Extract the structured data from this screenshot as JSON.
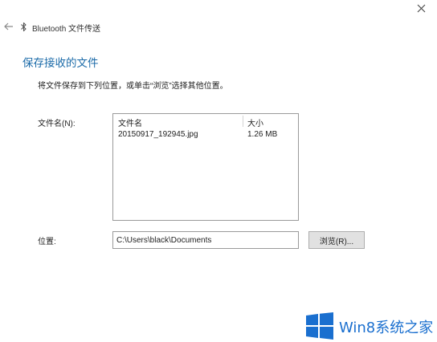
{
  "window": {
    "title": "Bluetooth 文件传送"
  },
  "page": {
    "title": "保存接收的文件",
    "instruction": "将文件保存到下列位置，或单击“浏览”选择其他位置。"
  },
  "files": {
    "label": "文件名(N):",
    "columns": {
      "name": "文件名",
      "size": "大小"
    },
    "rows": [
      {
        "name": "20150917_192945.jpg",
        "size": "1.26 MB"
      }
    ]
  },
  "location": {
    "label": "位置:",
    "value": "C:\\Users\\black\\Documents",
    "browse_label": "浏览(R)..."
  },
  "watermark": {
    "text": "Win8系统之家"
  },
  "colors": {
    "accent": "#1a6aa8",
    "watermark": "#1a6fcf"
  },
  "icons": [
    "back-arrow-icon",
    "bluetooth-icon",
    "close-icon",
    "windows-logo-icon"
  ]
}
